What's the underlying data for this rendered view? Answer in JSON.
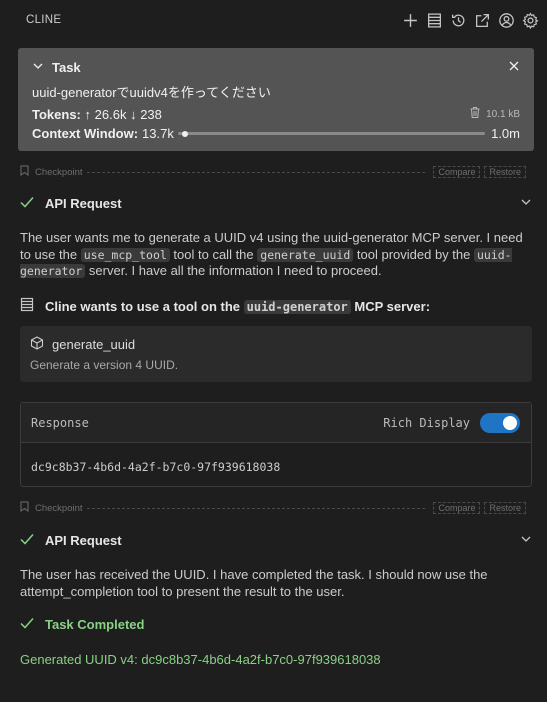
{
  "header": {
    "title": "CLINE",
    "icons": [
      "plus-icon",
      "server-icon",
      "history-icon",
      "external-link-icon",
      "account-icon",
      "gear-icon"
    ]
  },
  "task": {
    "label": "Task",
    "text": "uuid-generatorでuuidv4を作ってください",
    "tokens_label": "Tokens:",
    "tokens_in": "26.6k",
    "tokens_out": "238",
    "size": "10.1 kB",
    "context_label": "Context Window:",
    "context_used": "13.7k",
    "context_max": "1.0m",
    "context_fraction": 0.0137
  },
  "checkpoint": {
    "label": "Checkpoint",
    "compare": "Compare",
    "restore": "Restore"
  },
  "api_request_1": {
    "title": "API Request",
    "text_1": "The user wants me to generate a UUID v4 using the uuid-generator MCP server. I need to use the ",
    "code_1": "use_mcp_tool",
    "text_2": " tool to call the ",
    "code_2": "generate_uuid",
    "text_3": " tool provided by the ",
    "code_3": "uuid-generator",
    "text_4": " server. I have all the information I need to proceed."
  },
  "mcp": {
    "prefix": "Cline wants to use a tool on the ",
    "server": "uuid-generator",
    "suffix": " MCP server:",
    "tool_name": "generate_uuid",
    "tool_desc": "Generate a version 4 UUID.",
    "response_label": "Response",
    "rich_display_label": "Rich Display",
    "rich_display_on": true,
    "response_value": "dc9c8b37-4b6d-4a2f-b7c0-97f939618038"
  },
  "api_request_2": {
    "title": "API Request",
    "text": "The user has received the UUID. I have completed the task. I should now use the attempt_completion tool to present the result to the user."
  },
  "completion": {
    "title": "Task Completed",
    "text": "Generated UUID v4: dc9c8b37-4b6d-4a2f-b7c0-97f939618038"
  },
  "colors": {
    "background": "#1e1e1e",
    "task_card": "#545454",
    "success": "#89d185",
    "toggle_on": "#1f74c4"
  }
}
